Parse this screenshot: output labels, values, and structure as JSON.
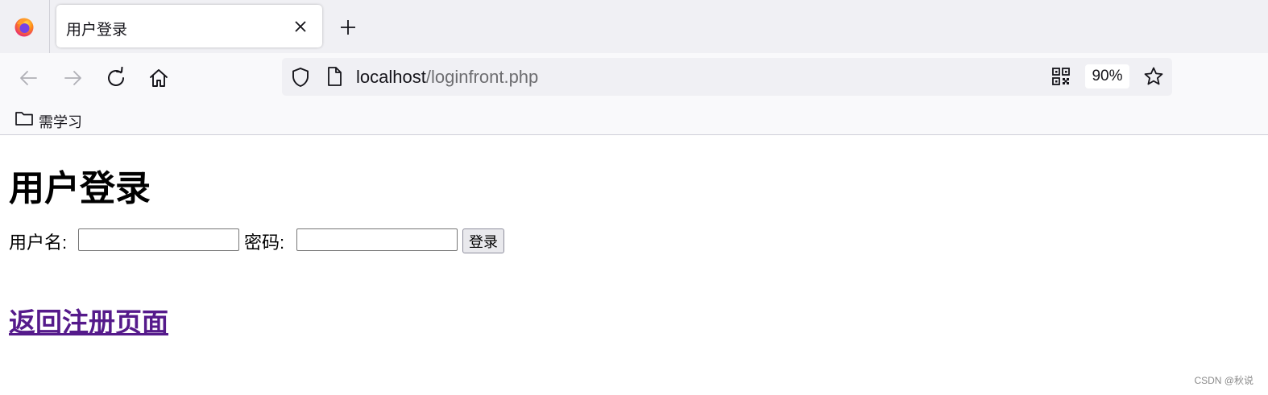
{
  "browser": {
    "tab": {
      "title": "用户登录"
    },
    "url": {
      "host": "localhost",
      "path": "/loginfront.php"
    },
    "zoom": "90%",
    "bookmarks": [
      {
        "label": "需学习"
      }
    ]
  },
  "page": {
    "heading": "用户登录",
    "form": {
      "username_label": "用户名:",
      "username_value": "",
      "password_label": "密码:",
      "password_value": "",
      "submit_label": "登录"
    },
    "back_link": "返回注册页面",
    "link_color": "#551a8b"
  },
  "watermark": "CSDN @秋说",
  "icons": [
    "firefox-icon",
    "close-icon",
    "plus-icon",
    "back-arrow-icon",
    "forward-arrow-icon",
    "reload-icon",
    "home-icon",
    "shield-icon",
    "page-icon",
    "qr-code-icon",
    "star-icon",
    "folder-icon"
  ]
}
